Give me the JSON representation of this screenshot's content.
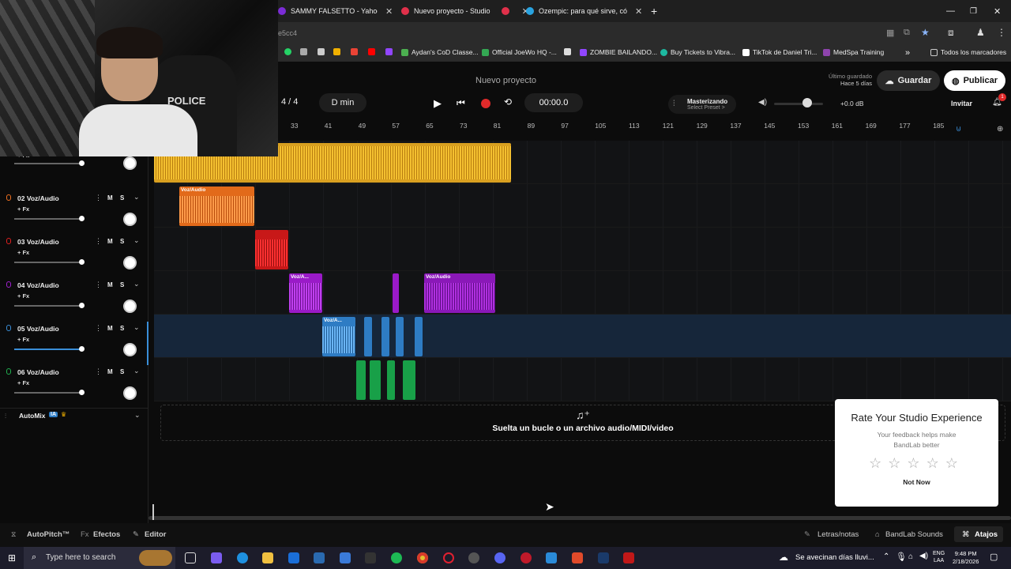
{
  "browser": {
    "tabs": [
      {
        "label": "SAMMY FALSETTO - Yahoo Sea",
        "color": "#7b2cd6"
      },
      {
        "label": "Nuevo proyecto - Studio",
        "color": "#e0304a"
      },
      {
        "label": "Ozempic: para qué sirve, cómo",
        "color": "#29a3e0"
      }
    ],
    "address_fragment": "e5cc4",
    "bookmarks": [
      {
        "label": "Aydan's CoD Classe...",
        "color": "#4caf50"
      },
      {
        "label": "Official JoeWo HQ -...",
        "color": "#34a853"
      },
      {
        "label": "ZOMBIE BAILANDO...",
        "color": "#9146ff"
      },
      {
        "label": "Buy Tickets to Vibra...",
        "color": "#1db9a0"
      },
      {
        "label": "TikTok de Daniel Tri...",
        "color": "#ffffff"
      },
      {
        "label": "MedSpa Training",
        "color": "#8e44ad"
      }
    ],
    "bookmarks_folder": "Todos los marcadores"
  },
  "studio": {
    "project_title": "Nuevo proyecto",
    "saved_status": "Último guardado",
    "saved_time": "Hace 5 días",
    "save_label": "Guardar",
    "publish_label": "Publicar",
    "time_signature": "4 / 4",
    "key": "D min",
    "time": "00:00.0",
    "mastering_label": "Masterizando",
    "mastering_preset": "Select Preset >",
    "volume_db": "+0.0 dB",
    "invite_label": "Invitar",
    "notif_count": "1",
    "ruler": [
      "33",
      "41",
      "49",
      "57",
      "65",
      "73",
      "81",
      "89",
      "97",
      "105",
      "113",
      "121",
      "129",
      "137",
      "145",
      "153",
      "161",
      "169",
      "177",
      "185"
    ]
  },
  "tracks": [
    {
      "name": "02 Voz/Audio",
      "fx": "+ Fx",
      "color": "#f07020",
      "mute": "M",
      "solo": "S"
    },
    {
      "name": "03 Voz/Audio",
      "fx": "+ Fx",
      "color": "#e02020",
      "mute": "M",
      "solo": "S"
    },
    {
      "name": "04 Voz/Audio",
      "fx": "+ Fx",
      "color": "#a020d0",
      "mute": "M",
      "solo": "S"
    },
    {
      "name": "05 Voz/Audio",
      "fx": "+ Fx",
      "color": "#3a8ed8",
      "mute": "M",
      "solo": "S"
    },
    {
      "name": "06 Voz/Audio",
      "fx": "+ Fx",
      "color": "#20b050",
      "mute": "M",
      "solo": "S"
    }
  ],
  "first_track_fx": "+ Fx",
  "clip_labels": {
    "c2": "Voz/Audio",
    "c4a": "Voz/A...",
    "c4b": "Voz/Audio",
    "c5": "Voz/A..."
  },
  "automix": {
    "label": "AutoMix",
    "badge": "IA"
  },
  "dropzone_text": "Suelta un bucle o un archivo audio/MIDI/video",
  "rating": {
    "title": "Rate Your Studio Experience",
    "subtitle": "Your feedback helps make BandLab better",
    "stars": 5,
    "dismiss": "Not Now"
  },
  "bottom": {
    "autopitch": "AutoPitch™",
    "effects": "Efectos",
    "editor": "Editor",
    "lyrics": "Letras/notas",
    "sounds": "BandLab Sounds",
    "shortcuts": "Atajos"
  },
  "taskbar": {
    "search_placeholder": "Type here to search",
    "weather": "Se avecinan días lluvi...",
    "lang_top": "ENG",
    "lang_bottom": "LAA",
    "time": "9:48 PM",
    "date": "2/18/2026"
  }
}
